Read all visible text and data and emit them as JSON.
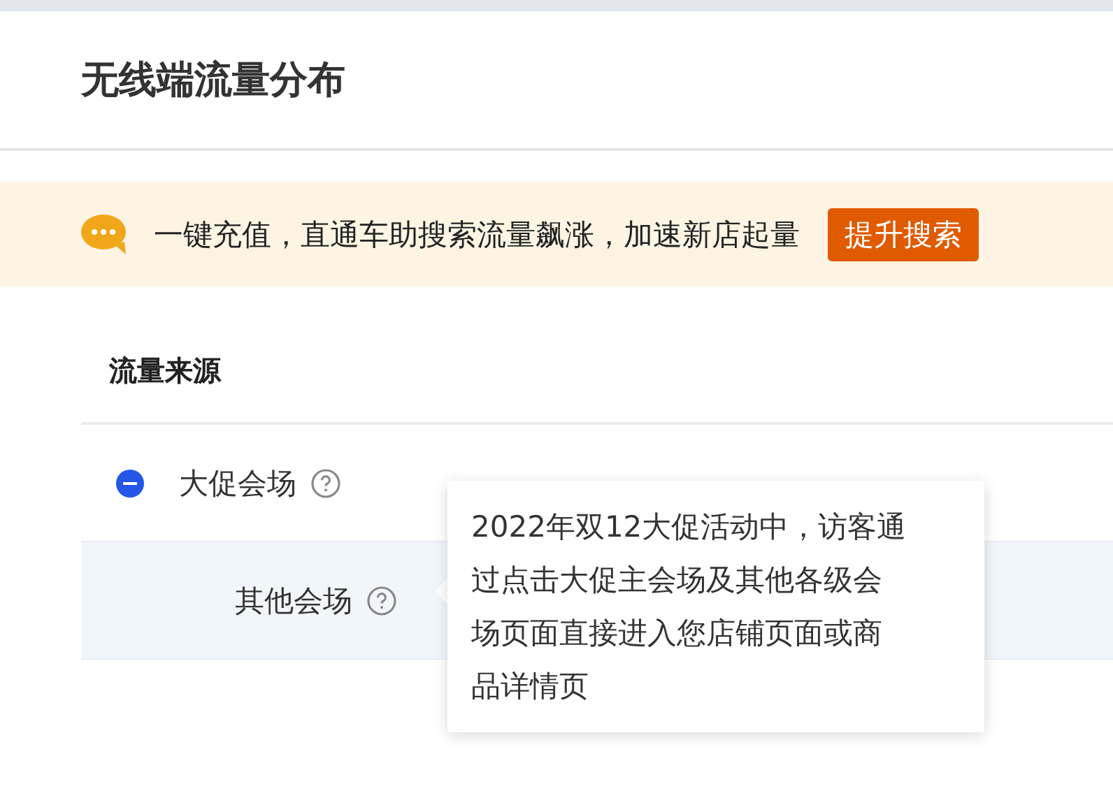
{
  "title": "无线端流量分布",
  "banner": {
    "text": "一键充值，直通车助搜索流量飙涨，加速新店起量",
    "button": "提升搜索"
  },
  "table": {
    "columns": [
      "流量来源"
    ],
    "rows": [
      {
        "label": "大促会场",
        "expanded": true,
        "selected": false,
        "children": [
          {
            "label": "其他会场",
            "selected": true
          }
        ]
      }
    ]
  },
  "tooltip": {
    "lines": [
      "2022年双12大促活动中，访客通",
      "过点击大促主会场及其他各级会",
      "场页面直接进入您店铺页面或商",
      "品详情页"
    ]
  }
}
